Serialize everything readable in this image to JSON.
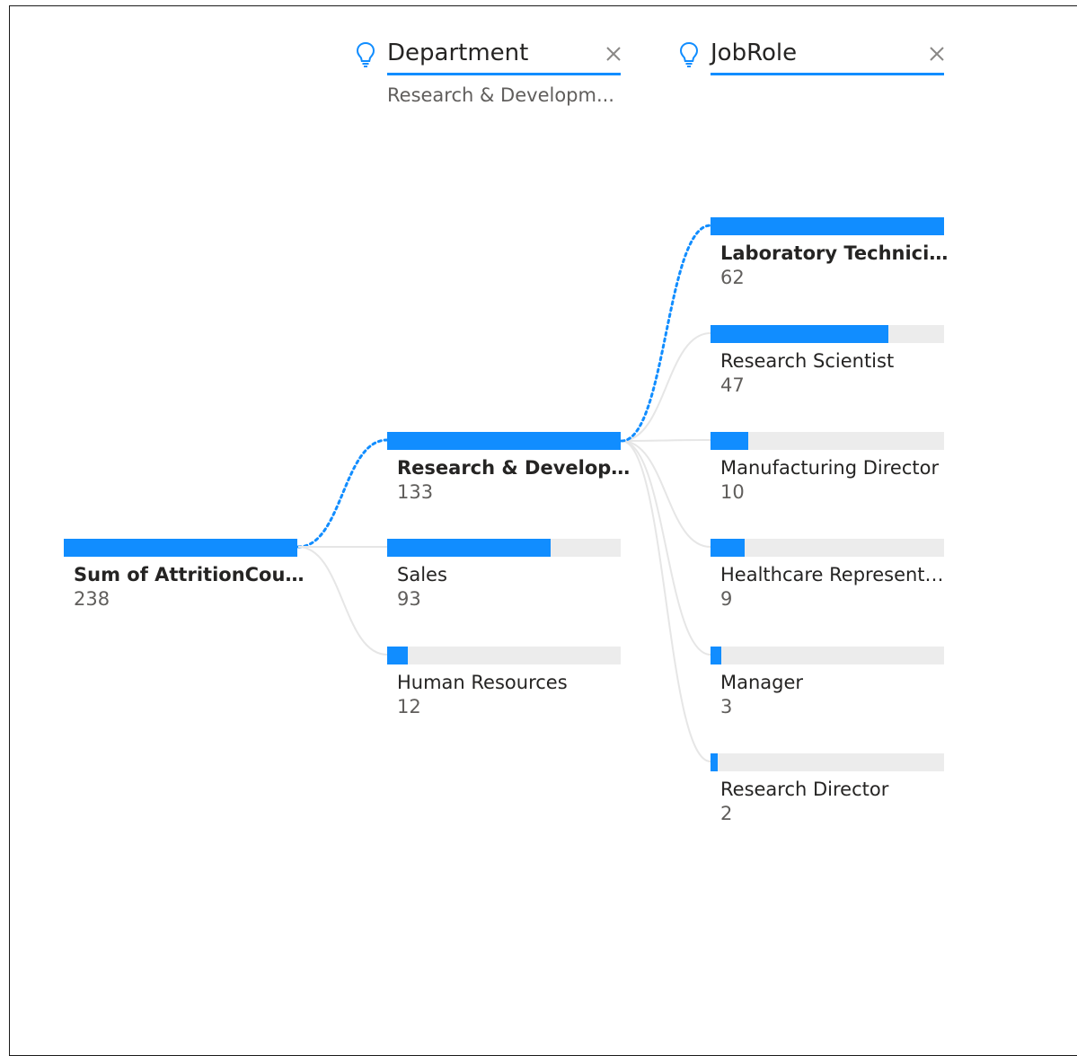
{
  "colors": {
    "accent": "#118DFF",
    "track": "#ececec",
    "line": "#e6e6e6"
  },
  "headers": [
    {
      "title": "Department",
      "subtitle": "Research & Developm...",
      "icon": "lightbulb-icon",
      "close_icon": "close-icon"
    },
    {
      "title": "JobRole",
      "subtitle": "",
      "icon": "lightbulb-icon",
      "close_icon": "close-icon"
    }
  ],
  "root": {
    "label": "Sum of AttritionCount",
    "value": "238",
    "fraction": 1.0
  },
  "departments": [
    {
      "label": "Research & Develop...",
      "value": "133",
      "fraction": 1.0,
      "selected": true
    },
    {
      "label": "Sales",
      "value": "93",
      "fraction": 0.7,
      "selected": false
    },
    {
      "label": "Human Resources",
      "value": "12",
      "fraction": 0.09,
      "selected": false
    }
  ],
  "jobroles": [
    {
      "label": "Laboratory Technician",
      "value": "62",
      "fraction": 1.0,
      "selected": true
    },
    {
      "label": "Research Scientist",
      "value": "47",
      "fraction": 0.76,
      "selected": false
    },
    {
      "label": "Manufacturing Director",
      "value": "10",
      "fraction": 0.16,
      "selected": false
    },
    {
      "label": "Healthcare Representa...",
      "value": "9",
      "fraction": 0.145,
      "selected": false
    },
    {
      "label": "Manager",
      "value": "3",
      "fraction": 0.048,
      "selected": false
    },
    {
      "label": "Research Director",
      "value": "2",
      "fraction": 0.032,
      "selected": false
    }
  ]
}
